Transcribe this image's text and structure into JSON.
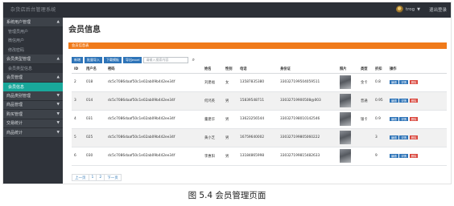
{
  "app": {
    "title": "杂货店后台管理系统",
    "user": "trog",
    "logout_label": "退出登录"
  },
  "sidebar": [
    {
      "label": "系统用户管理",
      "type": "group"
    },
    {
      "label": "管理员用户",
      "type": "item"
    },
    {
      "label": "微信用户",
      "type": "item"
    },
    {
      "label": "修改密码",
      "type": "item"
    },
    {
      "label": "会员类型管理",
      "type": "group"
    },
    {
      "label": "会员类型信息",
      "type": "item"
    },
    {
      "label": "会员管理",
      "type": "group"
    },
    {
      "label": "会员信息",
      "type": "item",
      "active": true
    },
    {
      "label": "商品类别管理",
      "type": "group"
    },
    {
      "label": "商品管理",
      "type": "group"
    },
    {
      "label": "购买管理",
      "type": "group"
    },
    {
      "label": "交易统计",
      "type": "group"
    },
    {
      "label": "商品统计",
      "type": "group"
    }
  ],
  "page": {
    "title": "会员信息",
    "panel_title": "会员信息表"
  },
  "toolbar": {
    "buttons": [
      "新增",
      "批量导入",
      "下载模板",
      "导出excel"
    ],
    "search_placeholder": "请输入搜索内容"
  },
  "table": {
    "headers": [
      "ID",
      "用户名",
      "密码",
      "姓名",
      "性别",
      "电话",
      "身份证",
      "照片",
      "类型",
      "折扣",
      "操作"
    ],
    "rows": [
      {
        "id": "2",
        "username": "018",
        "password": "dc5c7086daaf50c1e02ab09b442ee34f",
        "name": "刘建福",
        "gender": "女",
        "phone": "13587835380",
        "idcard": "330327199504059511",
        "type": "金卡",
        "discount": "0.8"
      },
      {
        "id": "3",
        "username": "014",
        "password": "dc5c7086daaf50c1e02ab09b442ee34f",
        "name": "何鸿英",
        "gender": "男",
        "phone": "15839548711",
        "idcard": "33032719900508@003",
        "type": "普通",
        "discount": "0.95"
      },
      {
        "id": "4",
        "username": "031",
        "password": "dc5c7086daaf50c1e02ab09b442ee34f",
        "name": "董建华",
        "gender": "男",
        "phone": "13623256544",
        "idcard": "330327198010142546",
        "type": "银卡",
        "discount": "0.9"
      },
      {
        "id": "5",
        "username": "025",
        "password": "dc5c7086daaf50c1e02ab09b442ee34f",
        "name": "黄小芝",
        "gender": "男",
        "phone": "16759640002",
        "idcard": "330327199805060222",
        "type": "",
        "discount": "3"
      },
      {
        "id": "6",
        "username": "030",
        "password": "dc5c7086daaf50c1e02ab09b442ee34f",
        "name": "李惠阳",
        "gender": "男",
        "phone": "13184865998",
        "idcard": "330327199815482633",
        "type": "",
        "discount": "9"
      }
    ],
    "op_labels": {
      "edit": "编辑",
      "detail": "详情",
      "delete": "删除"
    }
  },
  "pagination": {
    "prev": "上一页",
    "pages": [
      "1",
      "2"
    ],
    "next": "下一页"
  },
  "caption": "图 5.4 会员管理页面",
  "colors": {
    "sidebar_bg": "#2f333a",
    "active_item": "#19a89b",
    "panel_header": "#f07a1a",
    "primary_button": "#2e74b8",
    "delete_button": "#d9443a"
  }
}
